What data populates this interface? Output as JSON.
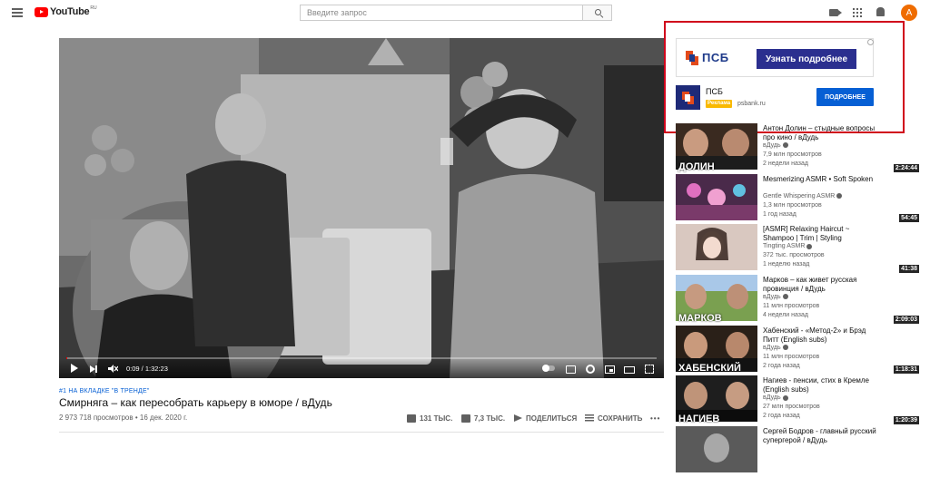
{
  "header": {
    "logo_text": "YouTube",
    "logo_region": "RU",
    "search_placeholder": "Введите запрос",
    "avatar_letter": "A"
  },
  "player": {
    "time": "0:09 / 1:32:23",
    "progress_fraction": 0.002
  },
  "video": {
    "trend_tag": "#1 НА ВКЛАДКЕ \"В ТРЕНДЕ\"",
    "title": "Смирняга – как пересобрать карьеру в юморе / вДудь",
    "meta": "2 973 718 просмотров • 16 дек. 2020 г.",
    "likes": "131 ТЫС.",
    "dislikes": "7,3 ТЫС.",
    "share": "ПОДЕЛИТЬСЯ",
    "save": "СОХРАНИТЬ",
    "more": "•••"
  },
  "ad": {
    "banner_brand": "ПСБ",
    "banner_cta": "Узнать подробнее",
    "card_name": "ПСБ",
    "badge": "Реклама",
    "domain": "psbank.ru",
    "cta": "ПОДРОБНЕЕ",
    "brand_color": "#2b2f8f"
  },
  "recommendations": [
    {
      "title": "Антон Долин – стыдные вопросы про кино / вДудь",
      "channel": "вДудь",
      "verified": true,
      "views": "7,9 млн просмотров",
      "age": "2 недели назад",
      "duration": "2:24:44",
      "caption": "ДОЛИН"
    },
    {
      "title": "Mesmerizing ASMR • Soft Spoken",
      "channel": "Gentle Whispering ASMR",
      "verified": true,
      "views": "1,3 млн просмотров",
      "age": "1 год назад",
      "duration": "54:45",
      "caption": ""
    },
    {
      "title": "[ASMR] Relaxing Haircut ~ Shampoo | Trim | Styling",
      "channel": "Tingting ASMR",
      "verified": true,
      "views": "372 тыс. просмотров",
      "age": "1 неделю назад",
      "duration": "41:38",
      "caption": ""
    },
    {
      "title": "Марков – как живет русская провинция / вДудь",
      "channel": "вДудь",
      "verified": true,
      "views": "11 млн просмотров",
      "age": "4 недели назад",
      "duration": "2:09:03",
      "caption": "МАРКОВ"
    },
    {
      "title": "Хабенский - «Метод-2» и Брэд Питт (English subs)",
      "channel": "вДудь",
      "verified": true,
      "views": "11 млн просмотров",
      "age": "2 года назад",
      "duration": "1:18:31",
      "caption": "ХАБЕНСКИЙ"
    },
    {
      "title": "Нагиев - пенсии, стих в Кремле (English subs)",
      "channel": "вДудь",
      "verified": true,
      "views": "27 млн просмотров",
      "age": "2 года назад",
      "duration": "1:20:39",
      "caption": "НАГИЕВ"
    },
    {
      "title": "Сергей Бодров - главный русский супергерой / вДудь",
      "channel": "",
      "verified": false,
      "views": "",
      "age": "",
      "duration": "",
      "caption": ""
    }
  ]
}
